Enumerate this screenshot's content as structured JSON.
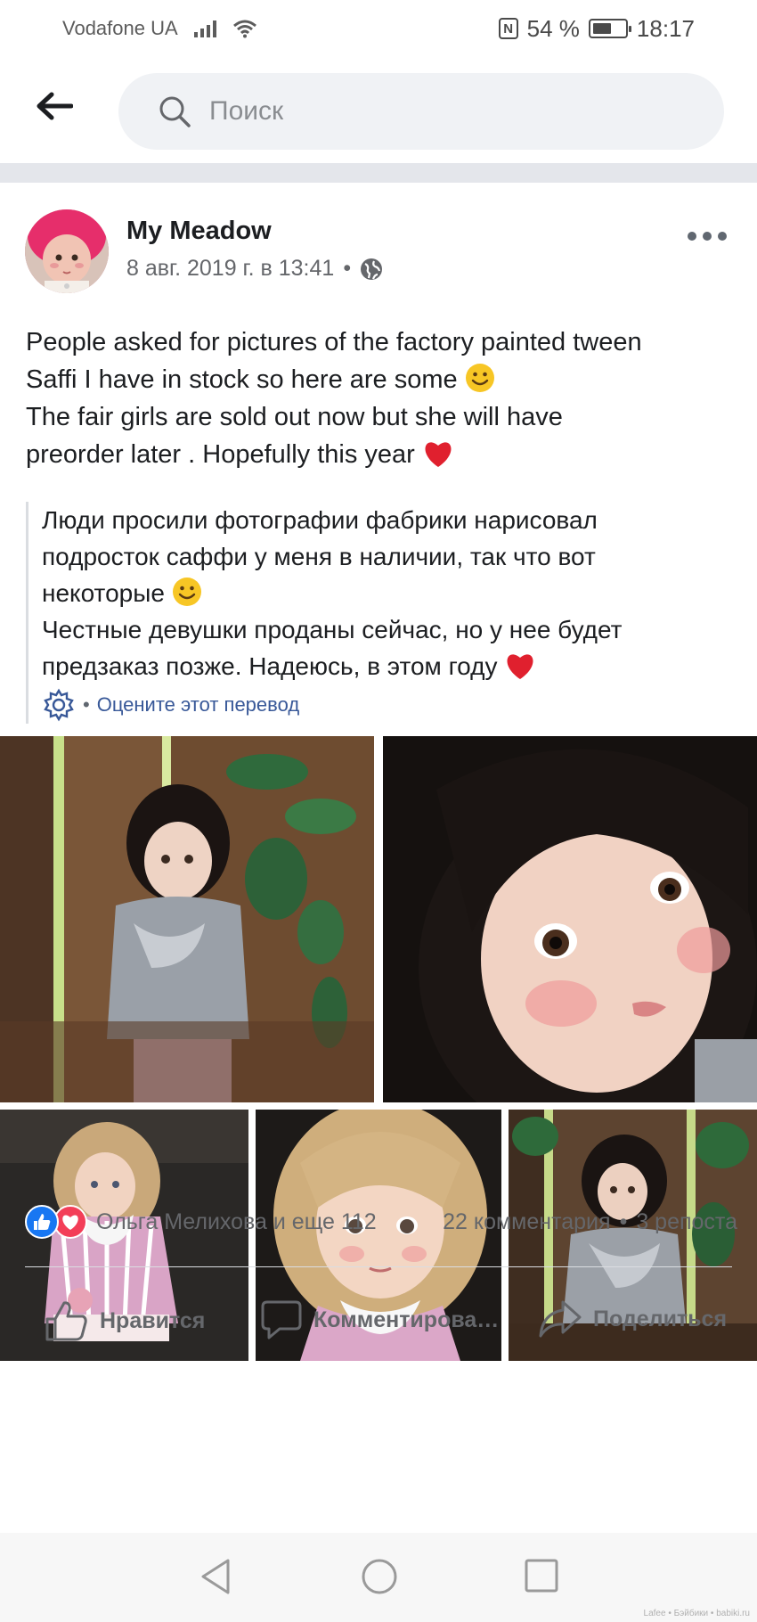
{
  "status_bar": {
    "carrier": "Vodafone UA",
    "battery_percent": "54 %",
    "time": "18:17"
  },
  "search": {
    "placeholder": "Поиск"
  },
  "post": {
    "author": "My Meadow",
    "timestamp": "8 авг. 2019 г. в 13:41",
    "meta_separator": "•",
    "privacy_icon": "globe-icon",
    "text_lines": [
      "People asked for pictures of the factory painted tween",
      "Saffi I have in stock so here are some ",
      "The fair girls are sold out now but she will have",
      "preorder later . Hopefully this year "
    ],
    "translation_lines": [
      "Люди просили фотографии фабрики нарисовал",
      "подросток саффи у меня в наличии, так что вот",
      "некоторые ",
      "Честные девушки проданы сейчас, но у нее будет",
      "предзаказ позже. Надеюсь, в этом году "
    ],
    "rate_translation": "Оцените этот перевод",
    "rate_separator": "•",
    "photos": [
      {
        "name": "photo-doll-dark-hair-fence",
        "icon": "photo"
      },
      {
        "name": "photo-doll-face-closeup",
        "icon": "photo"
      },
      {
        "name": "photo-doll-blonde-braids",
        "icon": "photo"
      },
      {
        "name": "photo-doll-blonde-portrait",
        "icon": "photo"
      },
      {
        "name": "photo-doll-dark-hair-sitting",
        "icon": "photo"
      }
    ],
    "reactions": {
      "types": [
        "like",
        "love"
      ],
      "reactors": "Ольга Мелихова и еще 112",
      "comments": "22 комментария",
      "separator": "•",
      "shares": "3 репоста"
    },
    "actions": {
      "like": "Нравится",
      "comment": "Комментирова…",
      "share": "Поделиться"
    }
  },
  "watermark": "Lafee • Бэйбики • babiki.ru",
  "colors": {
    "brand_blue": "#1877f2",
    "love_red": "#f33e58",
    "link_blue": "#385898",
    "secondary_text": "#65676b",
    "search_bg": "#f0f2f5"
  }
}
